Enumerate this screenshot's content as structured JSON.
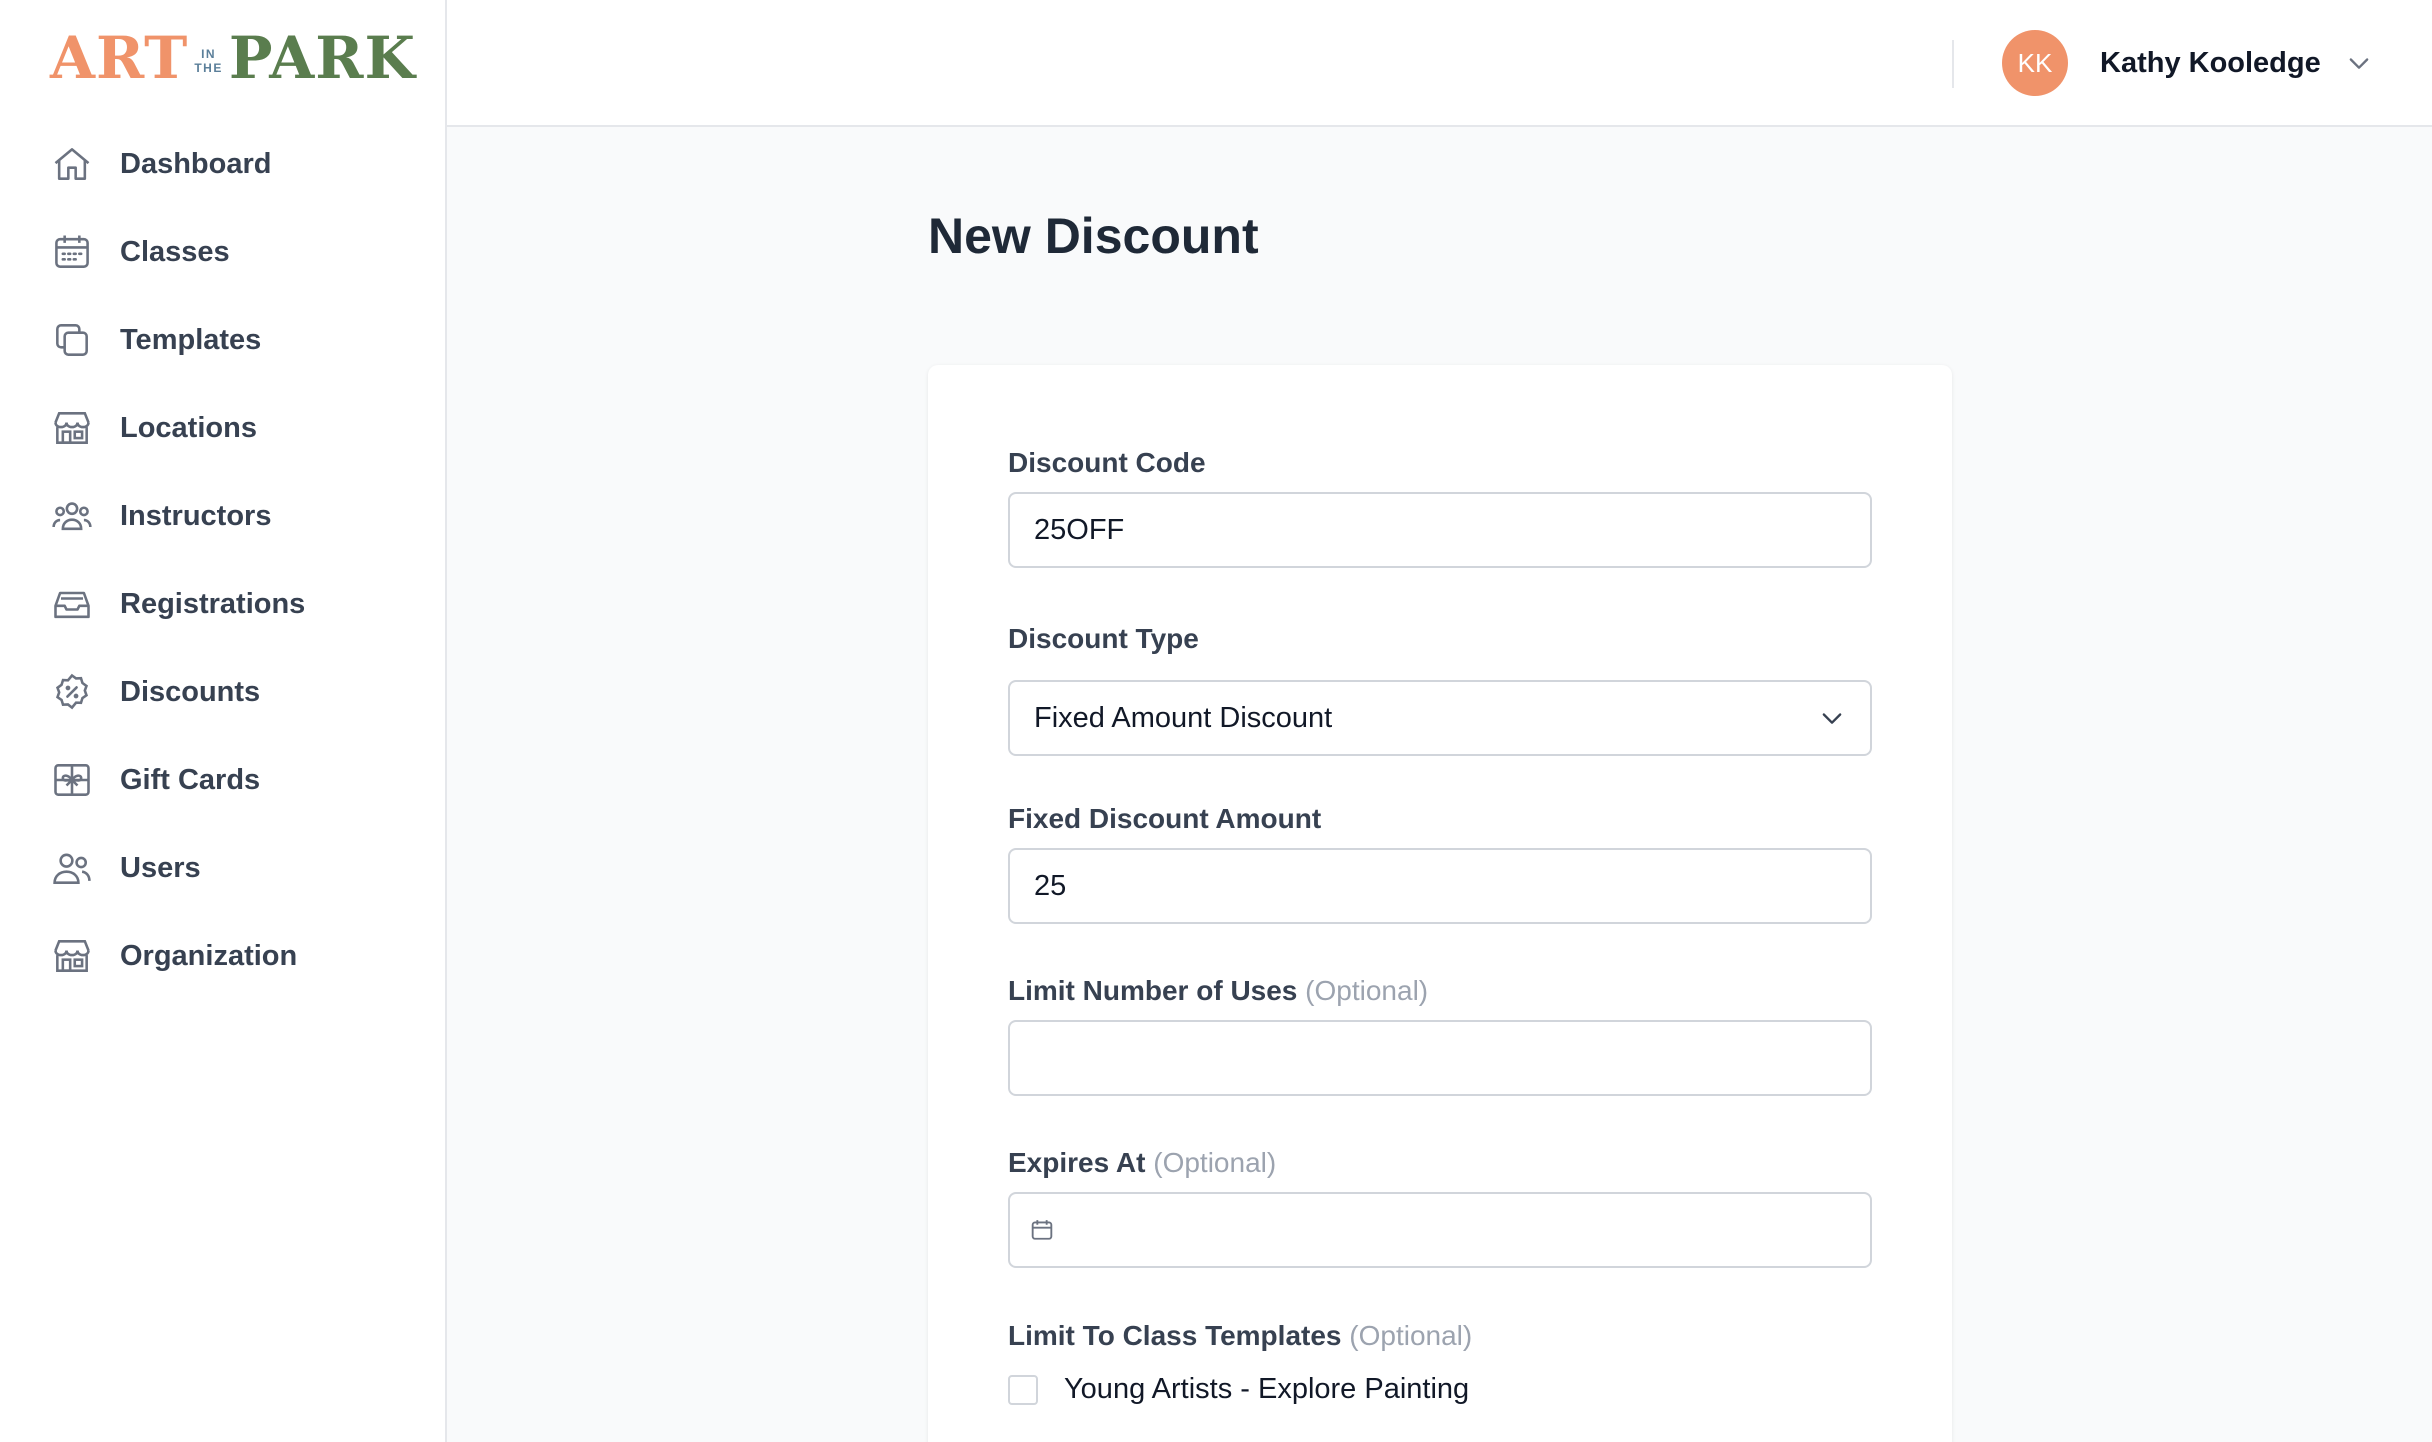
{
  "brand": {
    "word1": "ART",
    "mid1": "IN",
    "mid2": "THE",
    "word2": "PARK",
    "color_primary": "#f0936a",
    "color_secondary": "#5a7d4e"
  },
  "sidebar": {
    "items": [
      {
        "label": "Dashboard",
        "icon": "home-icon"
      },
      {
        "label": "Classes",
        "icon": "calendar-icon"
      },
      {
        "label": "Templates",
        "icon": "copy-icon"
      },
      {
        "label": "Locations",
        "icon": "storefront-icon"
      },
      {
        "label": "Instructors",
        "icon": "user-group-icon"
      },
      {
        "label": "Registrations",
        "icon": "inbox-stack-icon"
      },
      {
        "label": "Discounts",
        "icon": "percent-badge-icon"
      },
      {
        "label": "Gift Cards",
        "icon": "gift-icon"
      },
      {
        "label": "Users",
        "icon": "users-icon"
      },
      {
        "label": "Organization",
        "icon": "building-storefront-icon"
      }
    ]
  },
  "header": {
    "user": {
      "initials": "KK",
      "name": "Kathy Kooledge",
      "avatar_color": "#f0936a"
    }
  },
  "main": {
    "title": "New Discount",
    "form": {
      "discount_code": {
        "label": "Discount Code",
        "value": "25OFF"
      },
      "discount_type": {
        "label": "Discount Type",
        "value": "Fixed Amount Discount"
      },
      "fixed_amount": {
        "label": "Fixed Discount Amount",
        "value": "25"
      },
      "limit_uses": {
        "label": "Limit Number of Uses",
        "optional": "(Optional)",
        "value": ""
      },
      "expires_at": {
        "label": "Expires At",
        "optional": "(Optional)",
        "value": ""
      },
      "limit_templates": {
        "label": "Limit To Class Templates",
        "optional": "(Optional)",
        "options": [
          {
            "label": "Young Artists - Explore Painting",
            "checked": false
          }
        ]
      }
    }
  }
}
